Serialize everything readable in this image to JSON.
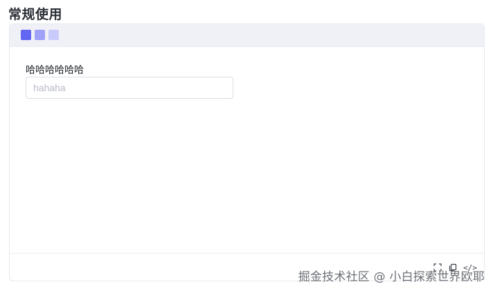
{
  "page": {
    "title": "常规使用"
  },
  "card": {
    "header_dots": [
      {
        "name": "dot-dark",
        "color": "#6366f1"
      },
      {
        "name": "dot-mid",
        "color": "#9fa2f6"
      },
      {
        "name": "dot-light",
        "color": "#c9cbfa"
      }
    ],
    "form": {
      "label": "哈哈哈哈哈哈",
      "input_placeholder": "hahaha",
      "input_value": ""
    },
    "footer": {
      "actions": [
        {
          "name": "fullscreen-icon",
          "glyph": "⛶"
        },
        {
          "name": "copy-icon",
          "glyph": "⧉"
        },
        {
          "name": "code-icon",
          "glyph": "</>"
        }
      ]
    }
  },
  "watermark": {
    "text": "掘金技术社区 @ 小白探索世界欧耶"
  }
}
